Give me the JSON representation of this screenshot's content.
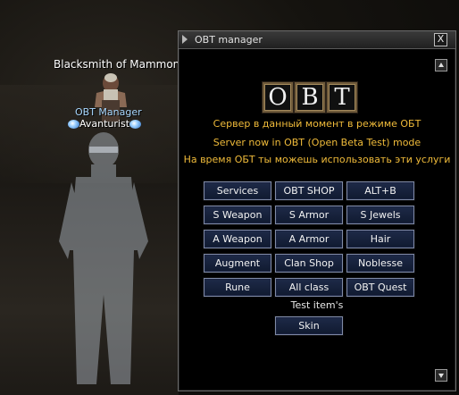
{
  "scene": {
    "npc_blacksmith": "Blacksmith of Mammon",
    "npc_manager_title": "OBT Manager",
    "npc_manager_name": "Avanturist"
  },
  "window": {
    "title": "OBT manager",
    "close_glyph": "X",
    "logo_letters": [
      "O",
      "B",
      "T"
    ],
    "info_lines": [
      "Сервер в данный момент в режиме ОБТ",
      "Server now in OBT (Open Beta Test) mode",
      "На время ОБТ ты можешь использовать эти услуги"
    ],
    "buttons": [
      [
        "Services",
        "OBT SHOP",
        "ALT+B"
      ],
      [
        "S Weapon",
        "S Armor",
        "S Jewels"
      ],
      [
        "A Weapon",
        "A Armor",
        "Hair"
      ],
      [
        "Augment",
        "Clan Shop",
        "Noblesse"
      ],
      [
        "Rune",
        "All class",
        "OBT Quest"
      ]
    ],
    "test_label": "Test item's",
    "skin_button": "Skin"
  },
  "colors": {
    "info_text": "#f0bb3a",
    "button_bg": "#1e2a48",
    "button_border": "#7f8aa6",
    "npc_title": "#a8d8ff"
  },
  "icons": [
    "scroll-up-icon",
    "scroll-down-icon",
    "close-icon",
    "title-arrow-icon",
    "mana-orb-icon"
  ]
}
